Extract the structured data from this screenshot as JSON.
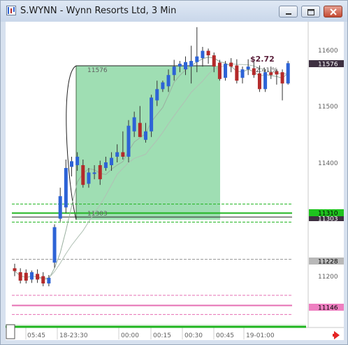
{
  "window": {
    "title": "S.WYNN - Wynn Resorts Ltd, 3 Min",
    "app_icon": "chart-app-icon",
    "controls": {
      "minimize": "minimize-icon",
      "maximize": "maximize-icon",
      "close": "close-icon"
    }
  },
  "colors": {
    "up_candle": "#2d63d6",
    "down_candle": "#b42a2a",
    "selection_fill": "#7fd39a",
    "price_line_green": "#1fb51f",
    "pink_line": "#e66fb3",
    "scroll_green": "#1fb51f",
    "nav_arrow": "#e52424"
  },
  "price_axis": {
    "labels": [
      "11600",
      "11500",
      "11400",
      "11200"
    ],
    "tags": [
      {
        "text": "11576",
        "bg": "#3d2f40",
        "fg": "#ffffff"
      },
      {
        "text": "11310",
        "bg": "#1ec21e",
        "fg": "#000000"
      },
      {
        "text": "11303",
        "bg": "#3d2f40",
        "fg": "#ffffff"
      },
      {
        "text": "11228",
        "bg": "#b8b8b8",
        "fg": "#000000"
      },
      {
        "text": "11146",
        "bg": "#ee7fc1",
        "fg": "#000000"
      }
    ]
  },
  "time_axis": {
    "labels": [
      "05:45",
      "18-23:30",
      "00:00",
      "00:15",
      "00:30",
      "00:45",
      "19-01:00"
    ]
  },
  "annotations": {
    "range_high": "11576",
    "range_low": "11303",
    "gain": "$2.72",
    "gain_pct": "2.41 %"
  },
  "chart_data": {
    "type": "candlestick",
    "symbol": "S.WYNN",
    "interval": "3 Min",
    "ylim": [
      11130,
      11660
    ],
    "candles": [
      {
        "o": 11212,
        "h": 11220,
        "l": 11198,
        "c": 11207,
        "dir": "down"
      },
      {
        "o": 11205,
        "h": 11212,
        "l": 11185,
        "c": 11190,
        "dir": "down"
      },
      {
        "o": 11204,
        "h": 11210,
        "l": 11185,
        "c": 11190,
        "dir": "down"
      },
      {
        "o": 11192,
        "h": 11208,
        "l": 11186,
        "c": 11205,
        "dir": "up"
      },
      {
        "o": 11202,
        "h": 11210,
        "l": 11186,
        "c": 11192,
        "dir": "down"
      },
      {
        "o": 11198,
        "h": 11205,
        "l": 11180,
        "c": 11185,
        "dir": "down"
      },
      {
        "o": 11185,
        "h": 11200,
        "l": 11180,
        "c": 11195,
        "dir": "up"
      },
      {
        "o": 11222,
        "h": 11290,
        "l": 11213,
        "c": 11285,
        "dir": "up"
      },
      {
        "o": 11300,
        "h": 11355,
        "l": 11295,
        "c": 11340,
        "dir": "up"
      },
      {
        "o": 11320,
        "h": 11405,
        "l": 11310,
        "c": 11390,
        "dir": "up"
      },
      {
        "o": 11392,
        "h": 11410,
        "l": 11375,
        "c": 11402,
        "dir": "up"
      },
      {
        "o": 11395,
        "h": 11418,
        "l": 11385,
        "c": 11410,
        "dir": "up"
      },
      {
        "o": 11395,
        "h": 11405,
        "l": 11355,
        "c": 11360,
        "dir": "down"
      },
      {
        "o": 11362,
        "h": 11390,
        "l": 11355,
        "c": 11382,
        "dir": "up"
      },
      {
        "o": 11382,
        "h": 11395,
        "l": 11370,
        "c": 11380,
        "dir": "up"
      },
      {
        "o": 11395,
        "h": 11403,
        "l": 11360,
        "c": 11370,
        "dir": "down"
      },
      {
        "o": 11390,
        "h": 11410,
        "l": 11385,
        "c": 11400,
        "dir": "up"
      },
      {
        "o": 11395,
        "h": 11418,
        "l": 11385,
        "c": 11408,
        "dir": "up"
      },
      {
        "o": 11410,
        "h": 11432,
        "l": 11400,
        "c": 11418,
        "dir": "up"
      },
      {
        "o": 11418,
        "h": 11455,
        "l": 11405,
        "c": 11410,
        "dir": "down"
      },
      {
        "o": 11410,
        "h": 11475,
        "l": 11400,
        "c": 11465,
        "dir": "up"
      },
      {
        "o": 11455,
        "h": 11490,
        "l": 11445,
        "c": 11480,
        "dir": "up"
      },
      {
        "o": 11470,
        "h": 11500,
        "l": 11460,
        "c": 11445,
        "dir": "down"
      },
      {
        "o": 11440,
        "h": 11470,
        "l": 11435,
        "c": 11455,
        "dir": "up"
      },
      {
        "o": 11455,
        "h": 11520,
        "l": 11445,
        "c": 11515,
        "dir": "up"
      },
      {
        "o": 11510,
        "h": 11545,
        "l": 11500,
        "c": 11530,
        "dir": "up"
      },
      {
        "o": 11530,
        "h": 11545,
        "l": 11525,
        "c": 11542,
        "dir": "up"
      },
      {
        "o": 11535,
        "h": 11565,
        "l": 11525,
        "c": 11555,
        "dir": "up"
      },
      {
        "o": 11555,
        "h": 11582,
        "l": 11545,
        "c": 11570,
        "dir": "up"
      },
      {
        "o": 11570,
        "h": 11580,
        "l": 11560,
        "c": 11575,
        "dir": "up"
      },
      {
        "o": 11565,
        "h": 11588,
        "l": 11555,
        "c": 11578,
        "dir": "up"
      },
      {
        "o": 11570,
        "h": 11607,
        "l": 11540,
        "c": 11580,
        "dir": "up"
      },
      {
        "o": 11578,
        "h": 11640,
        "l": 11560,
        "c": 11588,
        "dir": "up"
      },
      {
        "o": 11585,
        "h": 11605,
        "l": 11570,
        "c": 11598,
        "dir": "up"
      },
      {
        "o": 11598,
        "h": 11602,
        "l": 11575,
        "c": 11590,
        "dir": "down"
      },
      {
        "o": 11590,
        "h": 11595,
        "l": 11560,
        "c": 11570,
        "dir": "down"
      },
      {
        "o": 11577,
        "h": 11582,
        "l": 11545,
        "c": 11548,
        "dir": "down"
      },
      {
        "o": 11550,
        "h": 11580,
        "l": 11545,
        "c": 11575,
        "dir": "up"
      },
      {
        "o": 11577,
        "h": 11585,
        "l": 11560,
        "c": 11570,
        "dir": "down"
      },
      {
        "o": 11572,
        "h": 11583,
        "l": 11540,
        "c": 11545,
        "dir": "down"
      },
      {
        "o": 11550,
        "h": 11570,
        "l": 11540,
        "c": 11565,
        "dir": "up"
      },
      {
        "o": 11565,
        "h": 11583,
        "l": 11555,
        "c": 11570,
        "dir": "up"
      },
      {
        "o": 11567,
        "h": 11580,
        "l": 11550,
        "c": 11555,
        "dir": "down"
      },
      {
        "o": 11558,
        "h": 11572,
        "l": 11525,
        "c": 11530,
        "dir": "down"
      },
      {
        "o": 11530,
        "h": 11565,
        "l": 11525,
        "c": 11560,
        "dir": "up"
      },
      {
        "o": 11560,
        "h": 11570,
        "l": 11548,
        "c": 11555,
        "dir": "down"
      },
      {
        "o": 11556,
        "h": 11566,
        "l": 11538,
        "c": 11562,
        "dir": "down"
      },
      {
        "o": 11560,
        "h": 11565,
        "l": 11510,
        "c": 11540,
        "dir": "down"
      },
      {
        "o": 11540,
        "h": 11580,
        "l": 11538,
        "c": 11576,
        "dir": "up"
      }
    ]
  }
}
